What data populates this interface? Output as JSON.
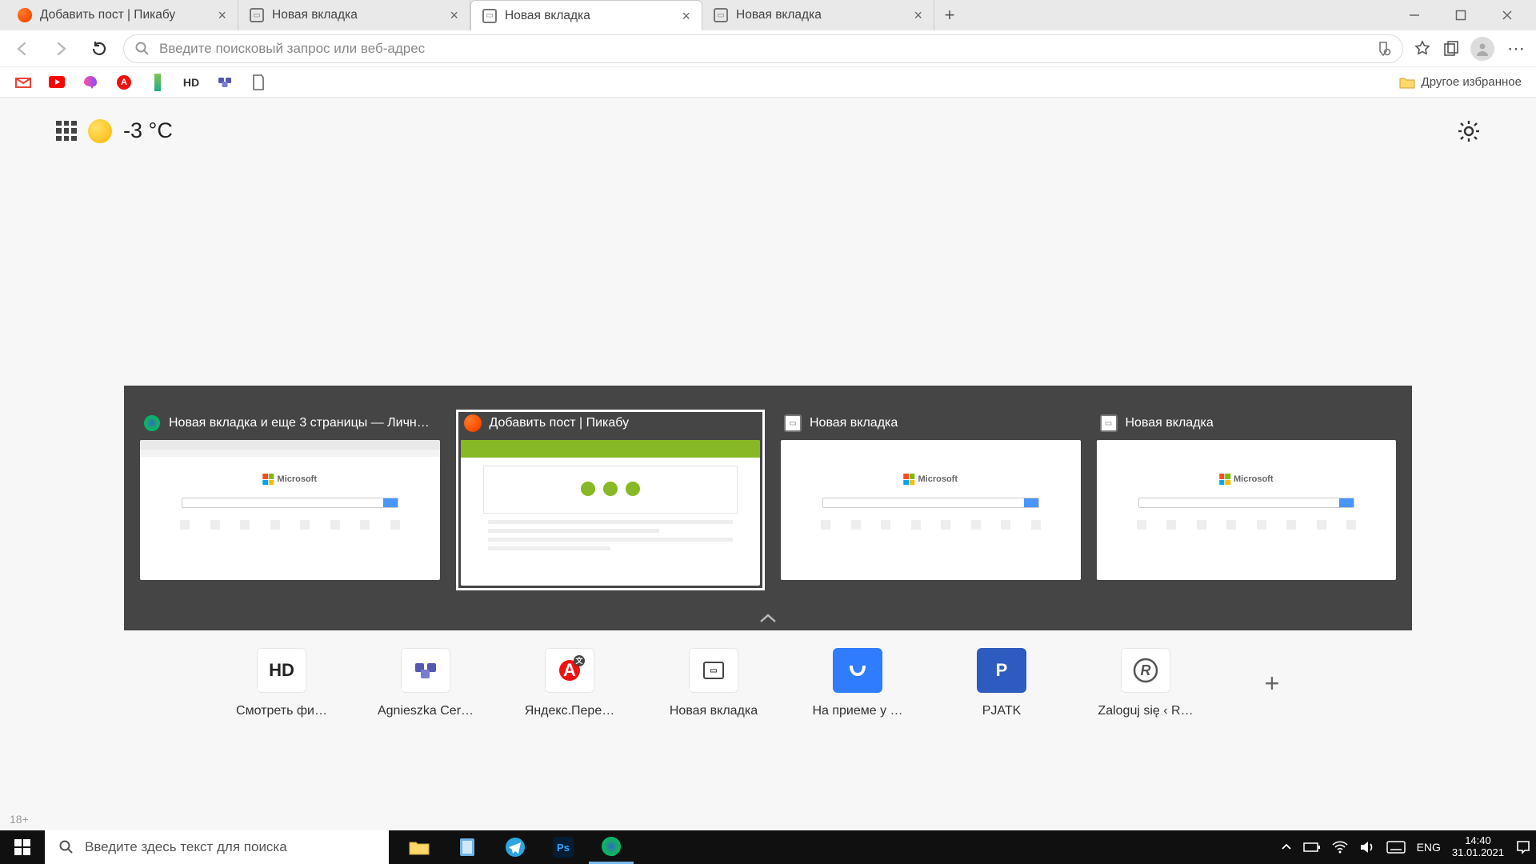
{
  "tabs": [
    {
      "title": "Добавить пост | Пикабу",
      "favicon": "pikabu"
    },
    {
      "title": "Новая вкладка",
      "favicon": "newtab"
    },
    {
      "title": "Новая вкладка",
      "favicon": "newtab",
      "active": true
    },
    {
      "title": "Новая вкладка",
      "favicon": "newtab"
    }
  ],
  "address": {
    "placeholder": "Введите поисковый запрос или веб-адрес"
  },
  "bookmarks_other": "Другое избранное",
  "weather": {
    "temp": "-3",
    "unit": "°C"
  },
  "ms_logo": "Microsoft",
  "switcher": [
    {
      "title": "Новая вкладка и еще 3 страницы — Личн…",
      "favicon": "edge",
      "thumb": "first"
    },
    {
      "title": "Добавить пост | Пикабу",
      "favicon": "pikabu",
      "thumb": "pika",
      "selected": true
    },
    {
      "title": "Новая вкладка",
      "favicon": "newtab",
      "thumb": "ms"
    },
    {
      "title": "Новая вкладка",
      "favicon": "newtab",
      "thumb": "ms"
    }
  ],
  "sites": [
    {
      "label": "Смотреть фи…",
      "tile_text": "HD",
      "tile_bg": "#ffffff",
      "tile_fg": "#222"
    },
    {
      "label": "Agnieszka Cer…",
      "tile_text": "",
      "tile_bg": "#ffffff",
      "tile_fg": "#555",
      "icon": "teams"
    },
    {
      "label": "Яндекс.Пере…",
      "tile_text": "",
      "tile_bg": "#ffffff",
      "icon": "yatrans"
    },
    {
      "label": "Новая вкладка",
      "tile_text": "",
      "tile_bg": "#ffffff",
      "icon": "newtab-dark"
    },
    {
      "label": "На приеме у …",
      "tile_text": "",
      "icon": "vk"
    },
    {
      "label": "PJATK",
      "tile_text": "P",
      "tile_bg": "#2d5bbf",
      "tile_fg": "#fff"
    },
    {
      "label": "Zaloguj się ‹ R…",
      "tile_text": "",
      "icon": "circle-r"
    }
  ],
  "age_rating": "18+",
  "taskbar": {
    "search_placeholder": "Введите здесь текст для поиска",
    "language": "ENG",
    "time": "14:40",
    "date": "31.01.2021"
  }
}
